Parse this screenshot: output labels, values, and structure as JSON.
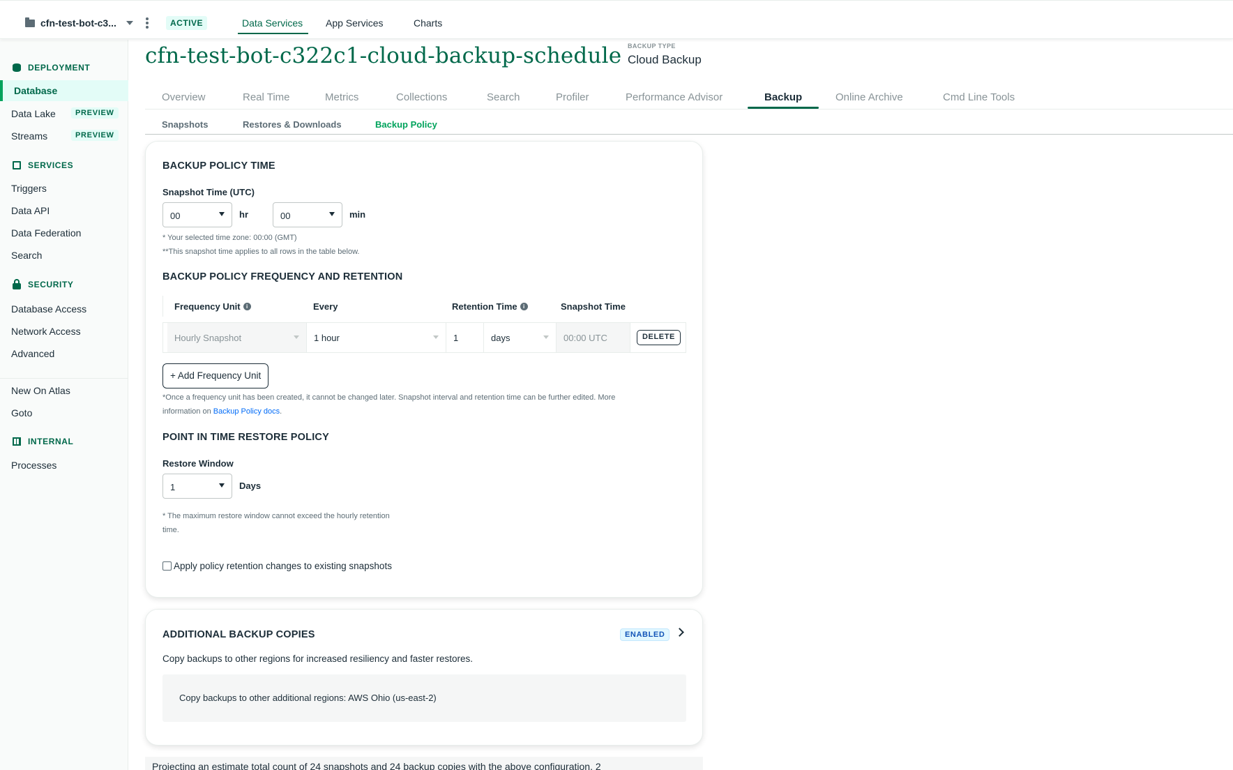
{
  "topbar": {
    "project_name": "cfn-test-bot-c3...",
    "status_badge": "ACTIVE",
    "nav": [
      "Data Services",
      "App Services",
      "Charts"
    ],
    "active_nav": "Data Services"
  },
  "sidebar": {
    "deployment_header": "DEPLOYMENT",
    "deployment_items": [
      {
        "label": "Database",
        "selected": true
      },
      {
        "label": "Data Lake",
        "badge": "PREVIEW"
      },
      {
        "label": "Streams",
        "badge": "PREVIEW"
      }
    ],
    "services_header": "SERVICES",
    "services_items": [
      "Triggers",
      "Data API",
      "Data Federation",
      "Search"
    ],
    "security_header": "SECURITY",
    "security_items": [
      "Database Access",
      "Network Access",
      "Advanced"
    ],
    "misc_items": [
      "New On Atlas",
      "Goto"
    ],
    "internal_header": "INTERNAL",
    "internal_items": [
      "Processes"
    ]
  },
  "header": {
    "cluster_title": "cfn-test-bot-c322c1-cloud-backup-schedule",
    "backup_type_label": "BACKUP TYPE",
    "backup_type_value": "Cloud Backup"
  },
  "tabs": [
    "Overview",
    "Real Time",
    "Metrics",
    "Collections",
    "Search",
    "Profiler",
    "Performance Advisor",
    "Backup",
    "Online Archive",
    "Cmd Line Tools"
  ],
  "active_tab": "Backup",
  "subtabs": [
    "Snapshots",
    "Restores & Downloads",
    "Backup Policy"
  ],
  "active_subtab": "Backup Policy",
  "policy_card": {
    "time_heading": "BACKUP POLICY TIME",
    "snapshot_time_label": "Snapshot Time (UTC)",
    "hour_value": "00",
    "hour_unit": "hr",
    "minute_value": "00",
    "minute_unit": "min",
    "timezone_note": "* Your selected time zone: 00:00 (GMT)",
    "applies_note": "**This snapshot time applies to all rows in the table below.",
    "frequency_heading": "BACKUP POLICY FREQUENCY AND RETENTION",
    "table_headers": {
      "frequency_unit": "Frequency Unit",
      "every": "Every",
      "retention_time": "Retention Time",
      "snapshot_time": "Snapshot Time"
    },
    "row": {
      "frequency_unit": "Hourly Snapshot",
      "every": "1 hour",
      "retention_value": "1",
      "retention_unit": "days",
      "snapshot_time": "00:00 UTC",
      "delete_label": "DELETE"
    },
    "add_button": "+ Add Frequency Unit",
    "frequency_note_line1": "*Once a frequency unit has been created, it cannot be changed later. Snapshot interval and retention time can be further edited. More",
    "frequency_note_prefix": "information on ",
    "frequency_note_link": "Backup Policy docs",
    "frequency_note_suffix": ".",
    "pit_heading": "POINT IN TIME RESTORE POLICY",
    "restore_window_label": "Restore Window",
    "restore_window_value": "1",
    "restore_window_unit": "Days",
    "restore_note_line1": "* The maximum restore window cannot exceed the hourly retention",
    "restore_note_line2": "time.",
    "apply_checkbox_label": "Apply policy retention changes to existing snapshots"
  },
  "copies_card": {
    "heading": "ADDITIONAL BACKUP COPIES",
    "status_badge": "ENABLED",
    "description": "Copy backups to other regions for increased resiliency and faster restores.",
    "regions_text": "Copy backups to other additional regions: AWS Ohio (us-east-2)"
  },
  "footer_text": "Projecting an estimate total count of 24 snapshots and 24 backup copies with the above configuration. 2",
  "colors": {
    "brand_green": "#00684a",
    "accent_green": "#00a35c",
    "badge_bg": "#e3fcf7",
    "link_blue": "#016bf8"
  }
}
